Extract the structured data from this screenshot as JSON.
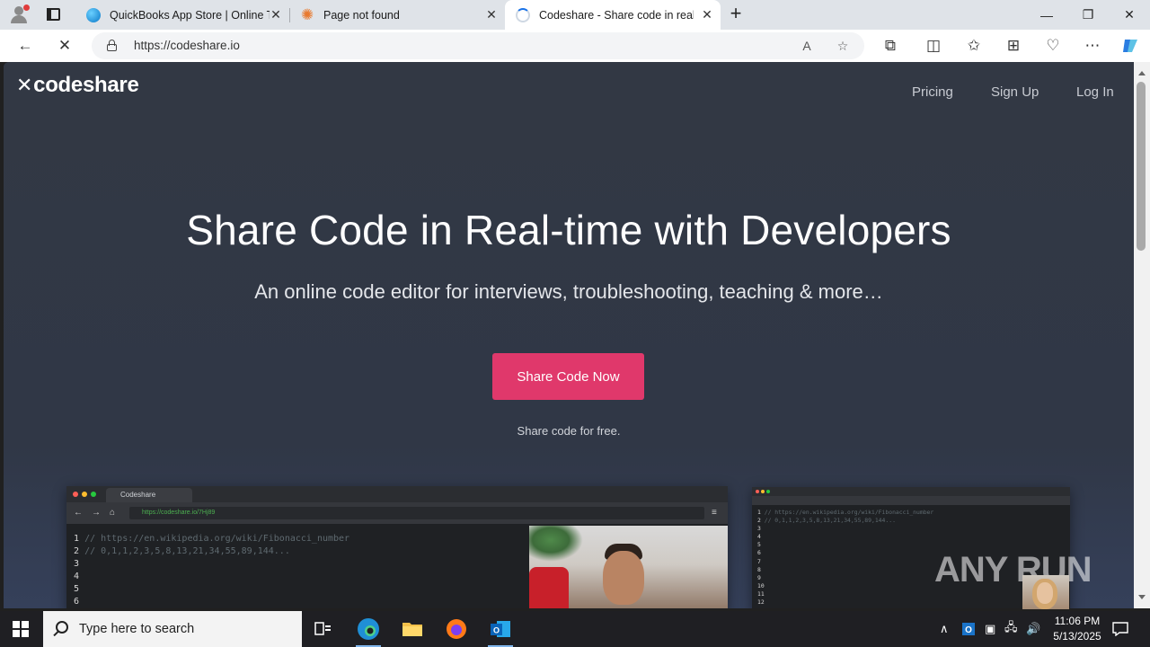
{
  "browser": {
    "tabs": [
      {
        "title": "QuickBooks App Store | Online To",
        "favicon": "quickbooks-icon"
      },
      {
        "title": "Page not found",
        "favicon": "gear-icon"
      },
      {
        "title": "Codeshare - Share code in real-ti",
        "favicon": "loading-spinner-icon",
        "active": true
      }
    ],
    "new_tab_label": "+",
    "url": "https://codeshare.io"
  },
  "site": {
    "logo": "codeshare",
    "nav": [
      "Pricing",
      "Sign Up",
      "Log In"
    ],
    "hero_title": "Share Code in Real-time with Developers",
    "hero_subtitle": "An online code editor for interviews, troubleshooting, teaching & more…",
    "cta_label": "Share Code Now",
    "cta_color": "#e0386b",
    "cta_note": "Share code for free.",
    "background_color": "#323844"
  },
  "screenshots": {
    "left": {
      "tab_label": "Codeshare",
      "url": "https://codeshare.io/7Hj89",
      "lines": [
        {
          "n": "1",
          "text": "// https://en.wikipedia.org/wiki/Fibonacci_number"
        },
        {
          "n": "2",
          "text": "// 0,1,1,2,3,5,8,13,21,34,55,89,144..."
        },
        {
          "n": "3",
          "text": ""
        },
        {
          "n": "4",
          "text": ""
        },
        {
          "n": "5",
          "text": ""
        },
        {
          "n": "6",
          "text": ""
        }
      ]
    },
    "right": {
      "lines": [
        {
          "n": "1",
          "text": "// https://en.wikipedia.org/wiki/Fibonacci_number"
        },
        {
          "n": "2",
          "text": "// 0,1,1,2,3,5,8,13,21,34,55,89,144..."
        },
        {
          "n": "3",
          "text": ""
        },
        {
          "n": "4",
          "text": ""
        },
        {
          "n": "5",
          "text": ""
        },
        {
          "n": "6",
          "text": ""
        },
        {
          "n": "7",
          "text": ""
        },
        {
          "n": "8",
          "text": ""
        },
        {
          "n": "9",
          "text": ""
        },
        {
          "n": "10",
          "text": ""
        },
        {
          "n": "11",
          "text": ""
        },
        {
          "n": "12",
          "text": ""
        }
      ]
    }
  },
  "watermark": "ANY RUN",
  "taskbar": {
    "search_placeholder": "Type here to search",
    "time": "11:06 PM",
    "date": "5/13/2025"
  }
}
